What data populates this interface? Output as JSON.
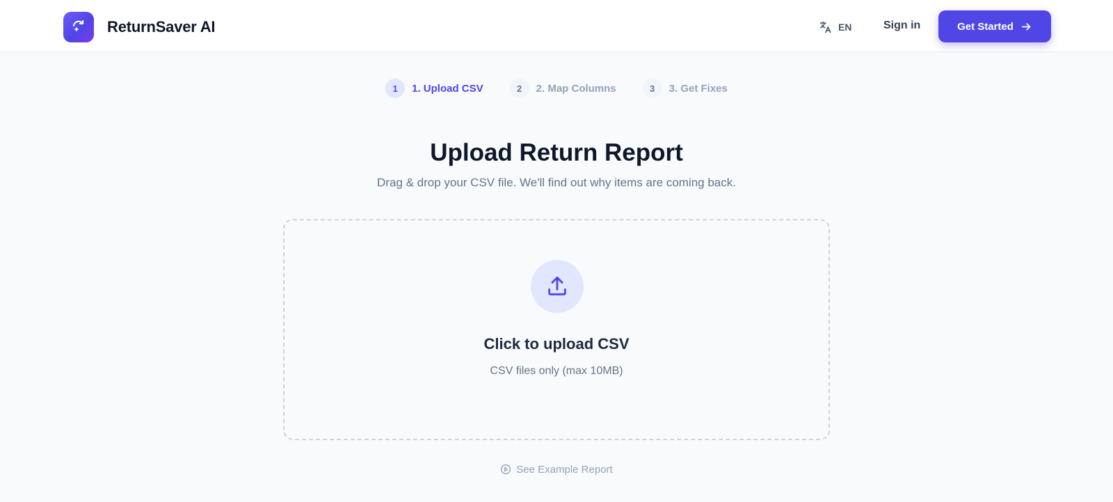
{
  "header": {
    "brand_name": "ReturnSaver AI",
    "logo_icon": "refresh-sparkle-icon",
    "language": {
      "icon": "translate-icon",
      "code": "EN"
    },
    "sign_in": "Sign in",
    "cta_label": "Get Started",
    "cta_icon": "arrow-right-icon"
  },
  "stepper": {
    "steps": [
      {
        "number": "1",
        "label": "1. Upload CSV",
        "state": "active"
      },
      {
        "number": "2",
        "label": "2. Map Columns",
        "state": "inactive"
      },
      {
        "number": "3",
        "label": "3. Get Fixes",
        "state": "inactive"
      }
    ]
  },
  "main": {
    "title": "Upload Return Report",
    "subtitle": "Drag & drop your CSV file. We'll find out why items are coming back.",
    "dropzone": {
      "icon": "upload-icon",
      "title": "Click to upload CSV",
      "hint": "CSV files only (max 10MB)"
    },
    "example_link": {
      "icon": "play-circle-icon",
      "label": "See Example Report"
    }
  },
  "colors": {
    "accent": "#4f46e5",
    "accent_light": "#e0e7ff",
    "background": "#f8fafc",
    "text_primary": "#0f172a",
    "text_muted": "#64748b"
  }
}
